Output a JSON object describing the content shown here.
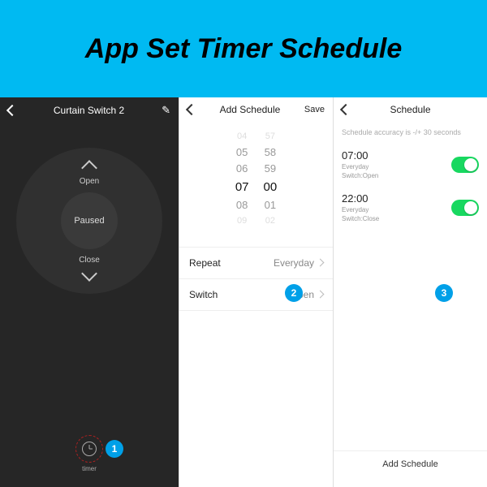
{
  "banner": {
    "title": "App Set Timer Schedule"
  },
  "panel1": {
    "title": "Curtain Switch 2",
    "open": "Open",
    "close": "Close",
    "status": "Paused",
    "timer": "timer",
    "step": "1"
  },
  "panel2": {
    "title": "Add Schedule",
    "save": "Save",
    "picker": {
      "h_prev2": "04",
      "h_prev": "05",
      "h_mid": "06",
      "h_sel": "07",
      "h_next": "08",
      "h_next2": "09",
      "m_prev2": "57",
      "m_prev": "58",
      "m_mid": "59",
      "m_sel": "00",
      "m_next": "01",
      "m_next2": "02"
    },
    "rows": {
      "repeat_label": "Repeat",
      "repeat_value": "Everyday",
      "switch_label": "Switch",
      "switch_value": "Open"
    },
    "step": "2"
  },
  "panel3": {
    "title": "Schedule",
    "hint": "Schedule accuracy is -/+ 30 seconds",
    "items": [
      {
        "time": "07:00",
        "sub1": "Everyday",
        "sub2": "Switch:Open"
      },
      {
        "time": "22:00",
        "sub1": "Everyday",
        "sub2": "Switch:Close"
      }
    ],
    "add": "Add Schedule",
    "step": "3"
  }
}
